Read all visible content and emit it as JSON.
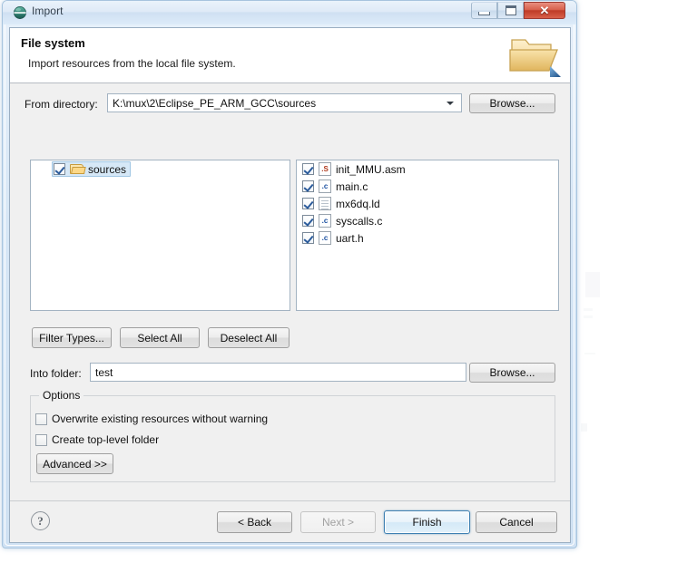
{
  "window": {
    "title": "Import",
    "title_icon": "eclipse-import-icon",
    "caption_buttons": [
      {
        "name": "minimize",
        "glyph": "minimize-icon"
      },
      {
        "name": "maximize",
        "glyph": "restore-icon"
      },
      {
        "name": "close",
        "glyph": "✕"
      }
    ]
  },
  "header": {
    "title": "File system",
    "description": "Import resources from the local file system.",
    "icon": "open-folder-icon"
  },
  "from_directory": {
    "label": "From directory:",
    "value": "K:\\mux\\2\\Eclipse_PE_ARM_GCC\\sources",
    "placeholder": "",
    "dropdown_icon": "chevron-down-icon",
    "browse_label": "Browse..."
  },
  "tree": {
    "items": [
      {
        "label": "sources",
        "checked": true,
        "selected": true,
        "icon": "folder-icon"
      }
    ]
  },
  "file_list": {
    "items": [
      {
        "label": "init_MMU.asm",
        "checked": true,
        "icon": "asm-file-icon",
        "glyph": ".S",
        "kind": "s"
      },
      {
        "label": "main.c",
        "checked": true,
        "icon": "c-file-icon",
        "glyph": ".c",
        "kind": "c"
      },
      {
        "label": "mx6dq.ld",
        "checked": true,
        "icon": "text-file-icon",
        "glyph": "",
        "kind": "doc"
      },
      {
        "label": "syscalls.c",
        "checked": true,
        "icon": "c-file-icon",
        "glyph": ".c",
        "kind": "c"
      },
      {
        "label": "uart.h",
        "checked": true,
        "icon": "c-file-icon",
        "glyph": ".c",
        "kind": "c"
      }
    ]
  },
  "selection_buttons": {
    "filter_types": "Filter Types...",
    "select_all": "Select All",
    "deselect_all": "Deselect All"
  },
  "into_folder": {
    "label": "Into folder:",
    "value": "test",
    "placeholder": "",
    "browse_label": "Browse..."
  },
  "options": {
    "legend": "Options",
    "checkboxes": [
      {
        "label": "Overwrite existing resources without warning",
        "checked": false
      },
      {
        "label": "Create top-level folder",
        "checked": false
      }
    ],
    "advanced_label": "Advanced >>"
  },
  "footer": {
    "help_icon": "?",
    "back_label": "< Back",
    "next_label": "Next >",
    "next_disabled": true,
    "finish_label": "Finish",
    "finish_is_default": true,
    "cancel_label": "Cancel"
  },
  "colors": {
    "accent": "#3c7fb1",
    "close_button": "#bf3b27",
    "selection": "#d6e8f7",
    "checkmark": "#2b5b9b",
    "folder": "#fcd888",
    "dialog_bg": "#f0f0f0"
  }
}
